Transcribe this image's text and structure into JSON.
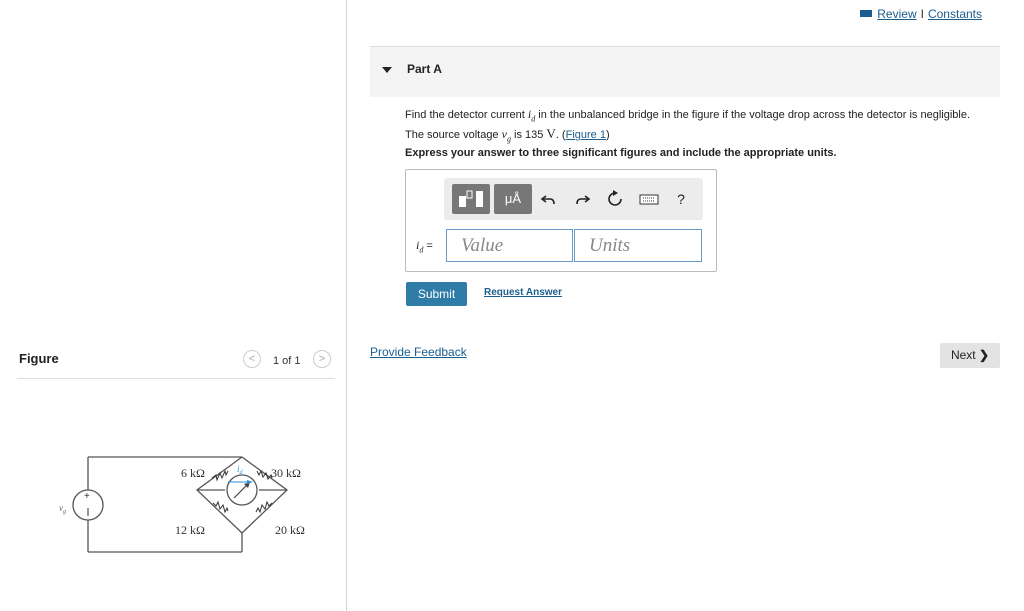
{
  "top_links": {
    "review": "Review",
    "separator": "I",
    "constants": "Constants"
  },
  "part": {
    "title": "Part A"
  },
  "question": {
    "line1_pre": "Find the detector current ",
    "var_id": "i",
    "var_id_sub": "d",
    "line1_post": " in the unbalanced bridge in the figure if the voltage drop across the detector is negligible.",
    "line2_pre": "The source voltage ",
    "var_vg": "v",
    "var_vg_sub": "g",
    "line2_mid": " is 135 ",
    "unit": "V",
    "line2_post": ". (",
    "figure_link": "Figure 1",
    "line2_end": ")"
  },
  "instruction": "Express your answer to three significant figures and include the appropriate units.",
  "toolbar": {
    "micro_amp": "μÅ",
    "help": "?"
  },
  "answer": {
    "label": "i",
    "label_sub": "d",
    "equals": " =",
    "value_placeholder": "Value",
    "units_placeholder": "Units"
  },
  "buttons": {
    "submit": "Submit",
    "request_answer": "Request Answer",
    "provide_feedback": "Provide Feedback",
    "next": "Next"
  },
  "figure": {
    "title": "Figure",
    "pager": "1 of 1",
    "labels": {
      "r1": "6 kΩ",
      "r2": "30 kΩ",
      "r3": "12 kΩ",
      "r4": "20 kΩ",
      "source": "v",
      "source_sub": "g",
      "current": "i",
      "current_sub": "d",
      "plus": "+"
    }
  },
  "colors": {
    "link": "#1a5e8f",
    "submit_bg": "#2f7ca8",
    "input_border": "#6a9dc7",
    "current_arrow": "#2a8fd6"
  }
}
